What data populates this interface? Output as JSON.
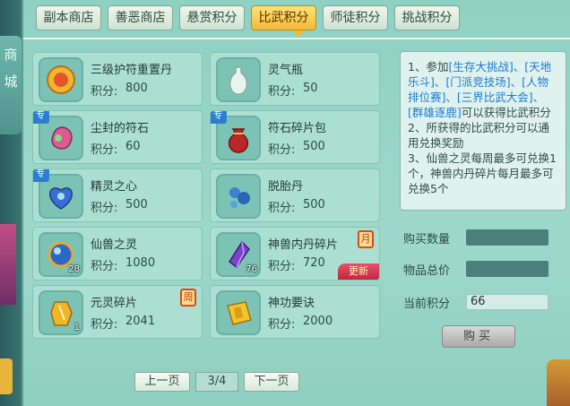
{
  "sidebar": {
    "label_line1": "商",
    "label_line2": "城"
  },
  "tabs": [
    {
      "label": "副本商店",
      "active": false
    },
    {
      "label": "善恶商店",
      "active": false
    },
    {
      "label": "悬赏积分",
      "active": false
    },
    {
      "label": "比武积分",
      "active": true
    },
    {
      "label": "师徒积分",
      "active": false
    },
    {
      "label": "挑战积分",
      "active": false
    }
  ],
  "score_label": "积分:",
  "items": [
    {
      "name": "三级护符重置丹",
      "score": "800",
      "icon": "medal-icon"
    },
    {
      "name": "灵气瓶",
      "score": "50",
      "icon": "vase-icon"
    },
    {
      "name": "尘封的符石",
      "score": "60",
      "icon": "gem-icon",
      "tag": "专"
    },
    {
      "name": "符石碎片包",
      "score": "500",
      "icon": "pouch-icon",
      "tag": "专"
    },
    {
      "name": "精灵之心",
      "score": "500",
      "icon": "heart-icon",
      "tag": "专"
    },
    {
      "name": "脱胎丹",
      "score": "500",
      "icon": "pill-icon"
    },
    {
      "name": "仙兽之灵",
      "score": "1080",
      "icon": "orb-icon",
      "count": "28"
    },
    {
      "name": "神兽内丹碎片",
      "score": "720",
      "icon": "crystal-icon",
      "count": "76",
      "badge": "月",
      "ribbon": "更新"
    },
    {
      "name": "元灵碎片",
      "score": "2041",
      "icon": "shard-icon",
      "count": "1",
      "badge": "周"
    },
    {
      "name": "神功要诀",
      "score": "2000",
      "icon": "book-icon"
    }
  ],
  "pager": {
    "prev": "上一页",
    "page": "3/4",
    "next": "下一页"
  },
  "info": {
    "line1_pre": "1、参加",
    "line1_links": "[生存大挑战]、[天地乐斗]、[门派竞技场]、[人物排位赛]、[三界比武大会]、[群雄逐鹿]",
    "line1_post": "可以获得比武积分",
    "line2": "2、所获得的比武积分可以通用兑换奖励",
    "line3": "3、仙兽之灵每周最多可兑换1个，神兽内丹碎片每月最多可兑换5个"
  },
  "side": {
    "qty_label": "购买数量",
    "total_label": "物品总价",
    "current_label": "当前积分",
    "current_value": "66",
    "buy_label": "购买"
  },
  "colors": {
    "panel": "#9ed8cb",
    "active_tab": "#f2b937",
    "link": "#1d7ad6"
  }
}
